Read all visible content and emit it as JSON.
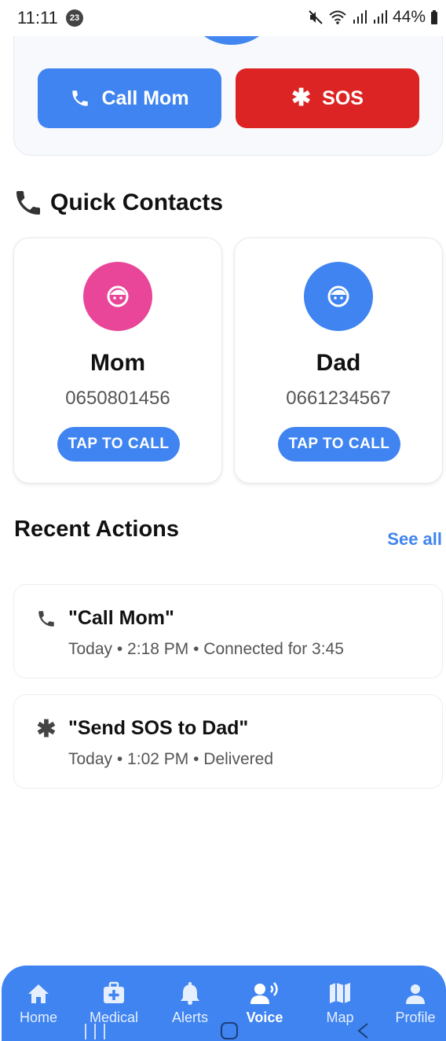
{
  "status_bar": {
    "time": "11:11",
    "notification_count": "23",
    "battery": "44%"
  },
  "top_card": {
    "call_button": "Call Mom",
    "sos_button": "SOS"
  },
  "quick_contacts": {
    "title": "Quick Contacts",
    "contacts": [
      {
        "name": "Mom",
        "phone": "0650801456",
        "button": "TAP TO CALL",
        "avatar_color": "#e9469a"
      },
      {
        "name": "Dad",
        "phone": "0661234567",
        "button": "TAP TO CALL",
        "avatar_color": "#3f84f0"
      }
    ]
  },
  "recent_actions": {
    "title": "Recent Actions",
    "see_all": "See all",
    "items": [
      {
        "icon": "phone-icon",
        "text": "\"Call Mom\"",
        "detail": "Today • 2:18 PM • Connected for 3:45"
      },
      {
        "icon": "asterisk-icon",
        "text": "\"Send SOS to Dad\"",
        "detail": "Today • 1:02 PM • Delivered"
      }
    ]
  },
  "bottom_nav": {
    "items": [
      {
        "label": "Home",
        "icon": "home-icon"
      },
      {
        "label": "Medical",
        "icon": "medical-kit-icon"
      },
      {
        "label": "Alerts",
        "icon": "bell-icon"
      },
      {
        "label": "Voice",
        "icon": "voice-icon",
        "active": true
      },
      {
        "label": "Map",
        "icon": "map-icon"
      },
      {
        "label": "Profile",
        "icon": "person-icon"
      }
    ]
  },
  "colors": {
    "primary": "#3f84f0",
    "sos": "#dd2424",
    "mom_avatar": "#e9469a"
  }
}
